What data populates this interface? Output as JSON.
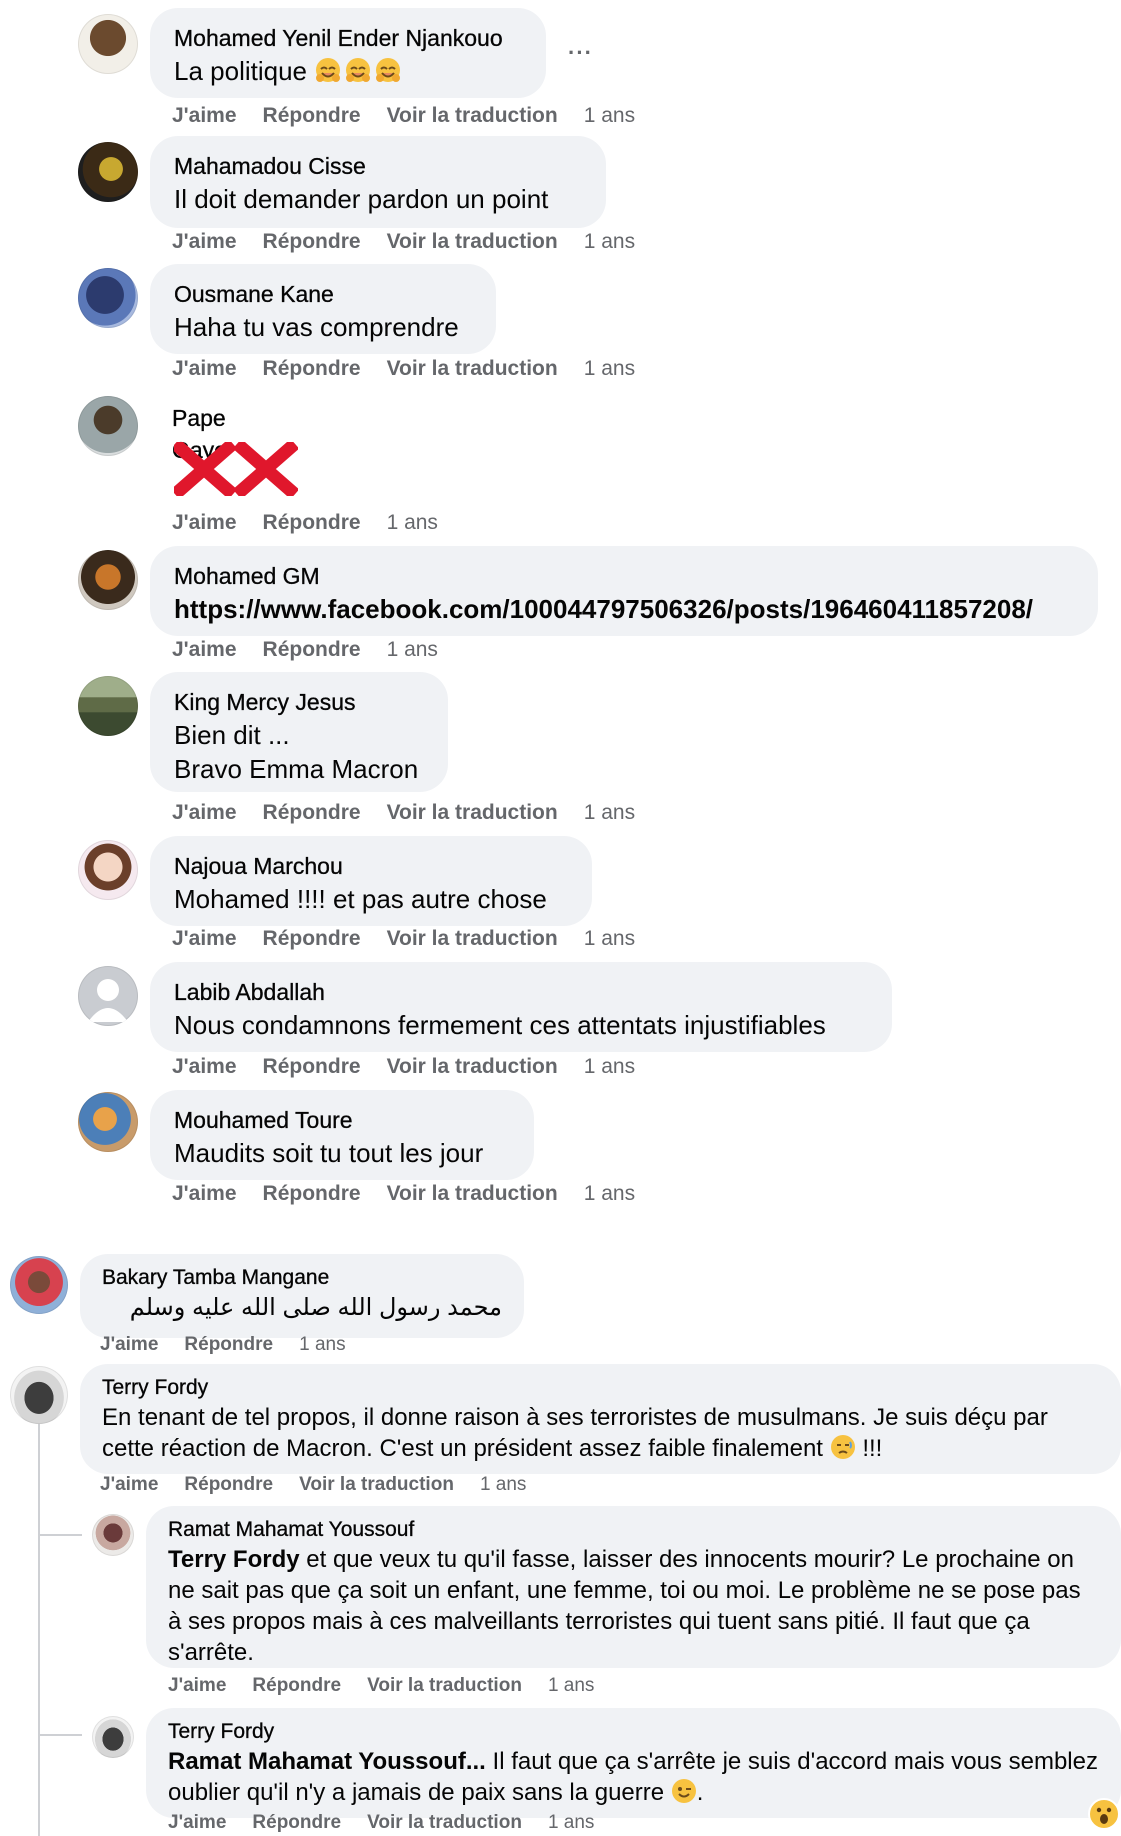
{
  "labels": {
    "like": "J'aime",
    "reply": "Répondre",
    "translate": "Voir la traduction",
    "more": "···"
  },
  "comments": [
    {
      "name": "Mohamed Yenil Ender Njankouo",
      "text": "La politique",
      "time": "1 ans"
    },
    {
      "name": "Mahamadou Cisse",
      "text": "Il doit demander pardon un point",
      "time": "1 ans"
    },
    {
      "name": "Ousmane Kane",
      "text": "Haha tu vas comprendre",
      "time": "1 ans"
    },
    {
      "name": "Pape Gaye",
      "text": "",
      "time": "1 ans"
    },
    {
      "name": "Mohamed GM",
      "text": "https://www.facebook.com/100044797506326/posts/196460411857208/",
      "time": "1 ans"
    },
    {
      "name": "King Mercy Jesus",
      "text": "Bien dit ...\nBravo Emma Macron",
      "time": "1 ans"
    },
    {
      "name": "Najoua Marchou",
      "text": "Mohamed !!!! et pas autre chose",
      "time": "1 ans"
    },
    {
      "name": "Labib Abdallah",
      "text": "Nous condamnons fermement ces attentats injustifiables",
      "time": "1 ans"
    },
    {
      "name": "Mouhamed Toure",
      "text": "Maudits soit tu tout les jour",
      "time": "1 ans"
    },
    {
      "name": "Bakary Tamba Mangane",
      "text": "محمد رسول الله صلى الله عليه وسلم",
      "time": "1 ans"
    },
    {
      "name": "Terry Fordy",
      "text": "En tenant de tel propos, il donne raison à ses terroristes de musulmans. Je suis déçu par cette réaction de Macron. C'est un président assez faible finalement",
      "text_end": "!!!",
      "time": "1 ans"
    },
    {
      "name": "Ramat Mahamat Youssouf",
      "mention": "Terry Fordy",
      "text": "et que veux tu qu'il fasse, laisser des innocents mourir? Le prochaine on ne sait pas que ça soit un enfant, une femme, toi ou moi. Le problème ne se pose pas à ses propos mais à ces malveillants terroristes qui tuent sans pitié. Il faut que ça s'arrête.",
      "time": "1 ans"
    },
    {
      "name": "Terry Fordy",
      "mention": "Ramat Mahamat Youssouf...",
      "text": "Il faut que ça s'arrête je suis d'accord mais vous semblez oublier qu'il n'y a jamais de paix sans la guerre",
      "text_end": ".",
      "time": "1 ans"
    }
  ],
  "colors": {
    "bubble": "#f0f2f5",
    "meta": "#65676b",
    "text": "#050505",
    "red_x": "#e0172c"
  }
}
